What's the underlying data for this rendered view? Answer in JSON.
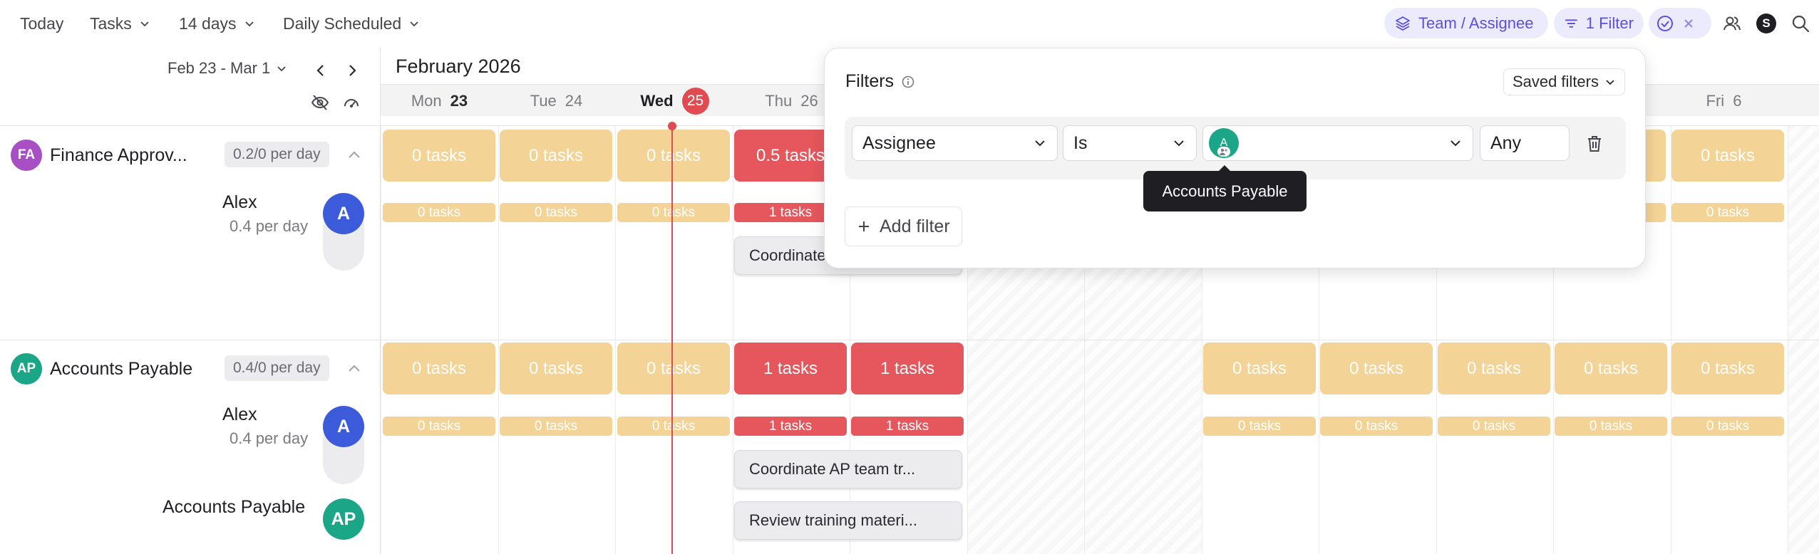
{
  "toolbar": {
    "today": "Today",
    "tasks": "Tasks",
    "range": "14 days",
    "mode": "Daily Scheduled",
    "team_assignee": "Team / Assignee",
    "filter": "1 Filter",
    "user_initial": "S"
  },
  "nav": {
    "date_range": "Feb 23 - Mar 1",
    "month": "February 2026"
  },
  "days": [
    {
      "dow": "Mon",
      "num": "23"
    },
    {
      "dow": "Tue",
      "num": "24"
    },
    {
      "dow": "Wed",
      "num": "25"
    },
    {
      "dow": "Thu",
      "num": "26"
    },
    {
      "dow": "Fri",
      "num": "6"
    }
  ],
  "groups": [
    {
      "initials": "FA",
      "name": "Finance Approv...",
      "rate": "0.2/0 per day",
      "color": "#a84fc4",
      "cells": [
        "0 tasks",
        "0 tasks",
        "0 tasks",
        "0.5 tasks",
        "0 tasks"
      ],
      "person": {
        "name": "Alex",
        "rate": "0.4 per day",
        "initial": "A",
        "color": "#3b5bdb"
      },
      "minis": [
        "0 tasks",
        "0 tasks",
        "0 tasks",
        "1 tasks",
        "0 tasks"
      ],
      "tasks": [
        "Coordinate"
      ]
    },
    {
      "initials": "AP",
      "name": "Accounts Payable",
      "rate": "0.4/0 per day",
      "color": "#1aa687",
      "cells": [
        "0 tasks",
        "0 tasks",
        "0 tasks",
        "1 tasks",
        "1 tasks",
        "0 tasks",
        "0 tasks",
        "0 tasks",
        "0 tasks",
        "0 tasks"
      ],
      "person": {
        "name": "Alex",
        "rate": "0.4 per day",
        "initial": "A",
        "color": "#3b5bdb"
      },
      "minis": [
        "0 tasks",
        "0 tasks",
        "0 tasks",
        "1 tasks",
        "1 tasks",
        "0 tasks",
        "0 tasks",
        "0 tasks",
        "0 tasks",
        "0 tasks"
      ],
      "tasks": [
        "Coordinate AP team tr...",
        "Review training materi..."
      ],
      "member": {
        "name": "Accounts Payable",
        "initials": "AP"
      }
    }
  ],
  "filters": {
    "title": "Filters",
    "saved": "Saved filters",
    "field": "Assignee",
    "operator": "Is",
    "value_initial": "A",
    "match": "Any",
    "add": "Add filter",
    "tooltip": "Accounts Payable"
  },
  "colors": {
    "accent": "#5b4fe0",
    "today": "#e04b52",
    "busy": "#e5575d",
    "free": "#f3d396"
  }
}
